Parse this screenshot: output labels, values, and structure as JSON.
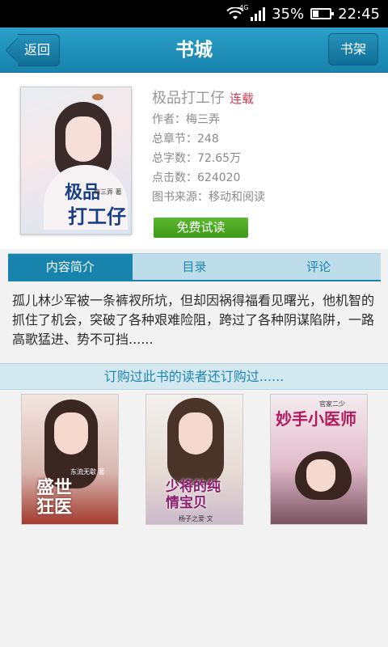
{
  "status_bar": {
    "network": "4G",
    "battery": "35%",
    "battery_level": 0.35,
    "time": "22:45",
    "icons": [
      "wifi-icon",
      "signal-icon",
      "battery-icon"
    ]
  },
  "header": {
    "title": "书城",
    "back_label": "返回",
    "shelf_label": "书架"
  },
  "book": {
    "title": "极品打工仔",
    "status": "连载",
    "author": "作者：梅三弄",
    "chapters": "总章节：248",
    "words": "总字数：72.65万",
    "clicks": "点击数：624020",
    "source": "图书来源：移动和阅读",
    "read_button": "免费试读",
    "cover": {
      "title_line1": "极品",
      "title_line2": "打工仔",
      "author": "梅三弄 著"
    }
  },
  "tabs": [
    {
      "label": "内容简介",
      "active": true
    },
    {
      "label": "目录",
      "active": false
    },
    {
      "label": "评论",
      "active": false
    }
  ],
  "description": "孤儿林少军被一条裤衩所坑，但却因祸得福看见曙光，他机智的抓住了机会，突破了各种艰难险阻，跨过了各种阴谋陷阱，一路高歌猛进、势不可挡......",
  "also_bought": {
    "heading": "订购过此书的读者还订购过......",
    "books": [
      {
        "title": "盛世狂医",
        "author": "东流无歇 著"
      },
      {
        "title": "少将的纯情宝贝",
        "author": "杨子之爱·文"
      },
      {
        "title": "妙手小医师",
        "author": "官家二少"
      }
    ]
  },
  "colors": {
    "header": "#1883ad",
    "accent": "#1f86ad",
    "status_red": "#d9394e",
    "button_green": "#4aa822"
  }
}
